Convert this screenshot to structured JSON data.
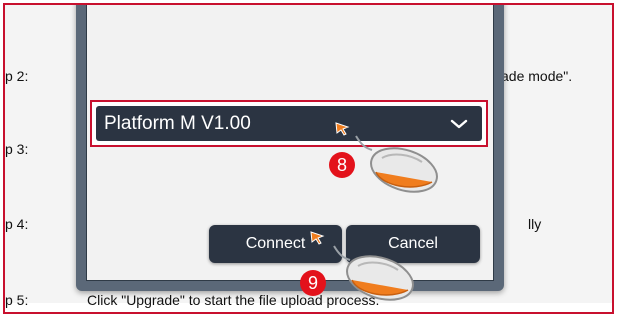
{
  "document": {
    "lines": [
      {
        "left_text": "p 2:",
        "right_text": "ade mode\"."
      },
      {
        "left_text": "p 3:",
        "right_text": ""
      },
      {
        "left_text": "p 4:",
        "right_text": "lly"
      },
      {
        "left_text": "p 5:",
        "right_text": "Click \"Upgrade\" to start the file upload process."
      }
    ]
  },
  "dialog": {
    "platform_select": {
      "value": "Platform M V1.00"
    },
    "connect_label": "Connect",
    "cancel_label": "Cancel"
  },
  "annotations": {
    "step_select": "8",
    "step_connect": "9"
  },
  "colors": {
    "highlight": "#c8102e",
    "badge": "#e3121b",
    "dialog_control": "#2b3442",
    "cursor": "#f07d1e"
  }
}
